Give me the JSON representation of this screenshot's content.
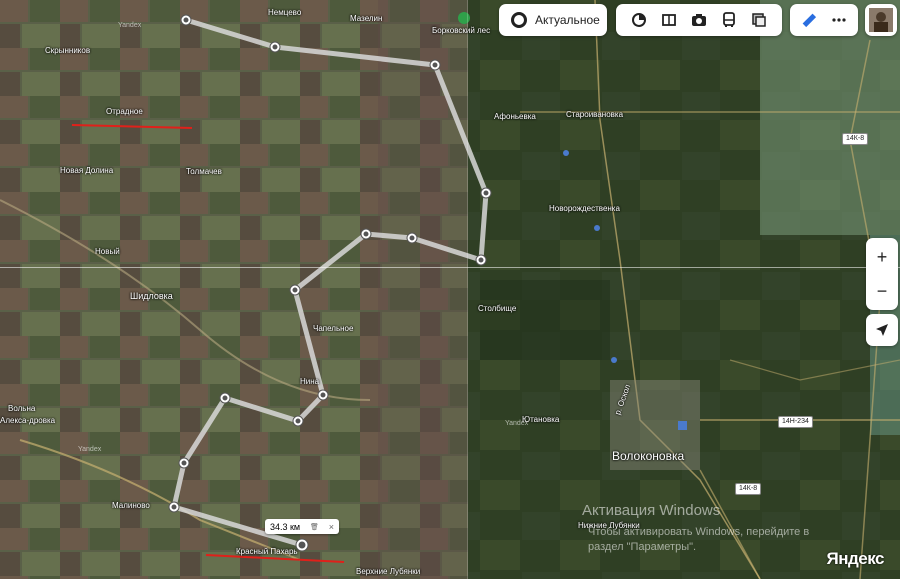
{
  "map_labels": {
    "nemtsevo": "Немцево",
    "mazelin": "Мазелин",
    "borkovsky": "Борковский лес",
    "skrynnikov": "Скрынников",
    "otradnoe": "Отрадное",
    "novaya_dolina": "Новая Долина",
    "tolmachev": "Толмачев",
    "novy": "Новый",
    "shidlovka": "Шидловка",
    "chapelnoe": "Чапельное",
    "nina": "Нина",
    "volnaya": "Вольна",
    "aleksandrovka": "Алекса-дровка",
    "malinovo": "Малиново",
    "krasny_pahar": "Красный Пахарь",
    "verkhnie_lubyanki": "Верхние Лубянки",
    "afonevka": "Афоньевка",
    "staroivanovka": "Староивановка",
    "novorozhdestvenka": "Новорождественка",
    "stolbishche": "Столбище",
    "yutanovka": "Ютановка",
    "volokonovka": "Волоконовка",
    "nizhnie_lubyanki": "Нижние Лубянки",
    "oskol": "р. Оскол"
  },
  "road_shields": {
    "r1": "14К-8",
    "r2": "14Н-234",
    "r3": "14К-8"
  },
  "toolbar": {
    "layer_label": "Актуальное"
  },
  "measure": {
    "distance": "34.3 км",
    "delete_symbol": "🗑",
    "close_symbol": "×"
  },
  "zoom": {
    "in": "+",
    "out": "−"
  },
  "watermarks": {
    "windows_title": "Активация Windows",
    "windows_text1": "Чтобы активировать Windows, перейдите в",
    "windows_text2": "раздел \"Параметры\".",
    "yandex_logo": "Яндекс",
    "yandex_small": "Yandex"
  },
  "route": {
    "colors": {
      "line": "#d8d8d8",
      "point": "#ffffff",
      "marker": "#e0201a"
    }
  },
  "icons": [
    "target-icon",
    "traffic-icon",
    "panorama-icon",
    "camera-icon",
    "bus-icon",
    "layers-icon",
    "ruler-icon",
    "more-icon",
    "avatar",
    "locate-icon"
  ]
}
